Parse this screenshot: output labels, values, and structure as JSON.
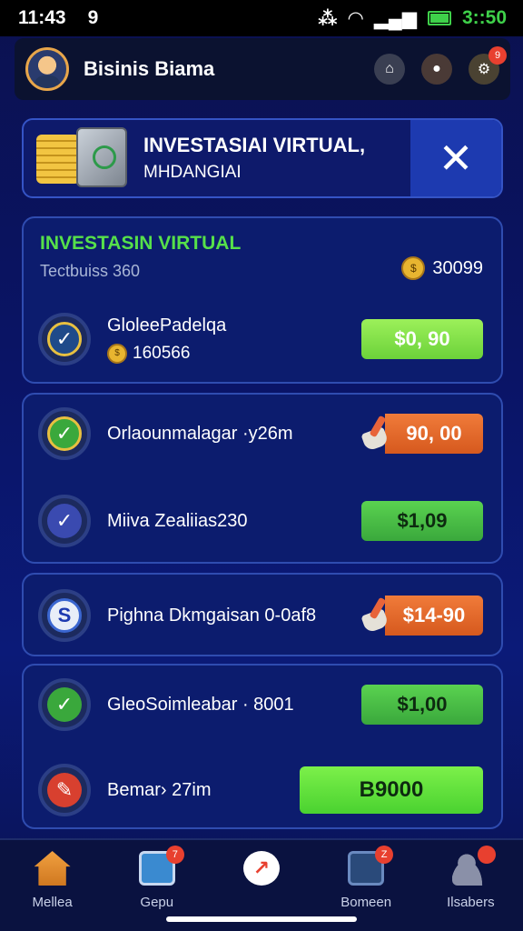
{
  "status_bar": {
    "time": "11:43",
    "notif": "9",
    "time_right": "3::50"
  },
  "header": {
    "title": "Bisinis Biama"
  },
  "banner": {
    "title": "INVESTASIAI VIRTUAL,",
    "subtitle": "MHDANGIAI",
    "close_glyph": "✕"
  },
  "overview": {
    "title": "INVESTASIN VIRTUAL",
    "subtitle": "Tectbuiss 360",
    "balance": "30099",
    "item": {
      "label": "GloleePadelqa",
      "meta": "160566",
      "button": "$0, 90"
    }
  },
  "list1": [
    {
      "label": "Orlaounmalagar ·y26m",
      "button": "90, 00"
    },
    {
      "label": "Miiva Zealiias230",
      "button": "$1,09"
    }
  ],
  "list2": [
    {
      "label": "Pighna Dkmgaisan 0-0af8",
      "button": "$14-90"
    }
  ],
  "list3": [
    {
      "label": "GleoSoimleabar · 8001",
      "button": "$1,00"
    },
    {
      "label": "Bemar› 27im",
      "button": "B9000"
    }
  ],
  "nav": [
    {
      "label": "Mellea",
      "icon": "home-icon"
    },
    {
      "label": "Gepu",
      "icon": "monitor-icon",
      "badge": "7"
    },
    {
      "label": "",
      "icon": "chart-center-icon"
    },
    {
      "label": "Bomeen",
      "icon": "inbox-icon",
      "badge": "Z"
    },
    {
      "label": "Ilsabers",
      "icon": "users-icon"
    }
  ],
  "colors": {
    "accent_green": "#56e04a",
    "orange": "#e8643a",
    "panel": "#0c1c6e"
  }
}
